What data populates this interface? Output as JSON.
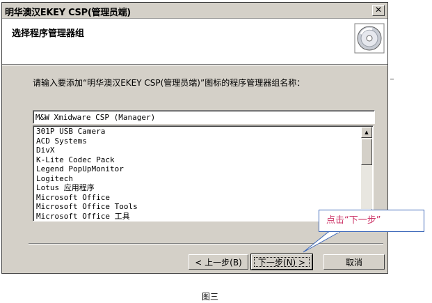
{
  "window": {
    "title": "明华澳汉EKEY CSP(管理员端)",
    "close_glyph": "✕"
  },
  "header": {
    "title": "选择程序管理器组",
    "icon": "cd-disc-icon"
  },
  "prompt": "请输入要添加“明华澳汉EKEY CSP(管理员端)”图标的程序管理器组名称：",
  "group_input": {
    "value": "M&W Xmidware CSP (Manager)"
  },
  "group_list": {
    "items": [
      "301P USB Camera",
      "ACD Systems",
      "DivX",
      "K-Lite Codec Pack",
      "Legend PopUpMonitor",
      "Logitech",
      "Lotus 应用程序",
      "Microsoft Office",
      "Microsoft Office Tools",
      "Microsoft Office 工具"
    ],
    "scroll_up_glyph": "▲",
    "scroll_down_glyph": "▼"
  },
  "buttons": {
    "back": "< 上一步(B)",
    "next": "下一步(N) >",
    "cancel": "取消"
  },
  "callout": {
    "text": "点击“下一步”",
    "border_color": "#3a66b8",
    "text_color": "#cc3366"
  },
  "caption": "图三"
}
